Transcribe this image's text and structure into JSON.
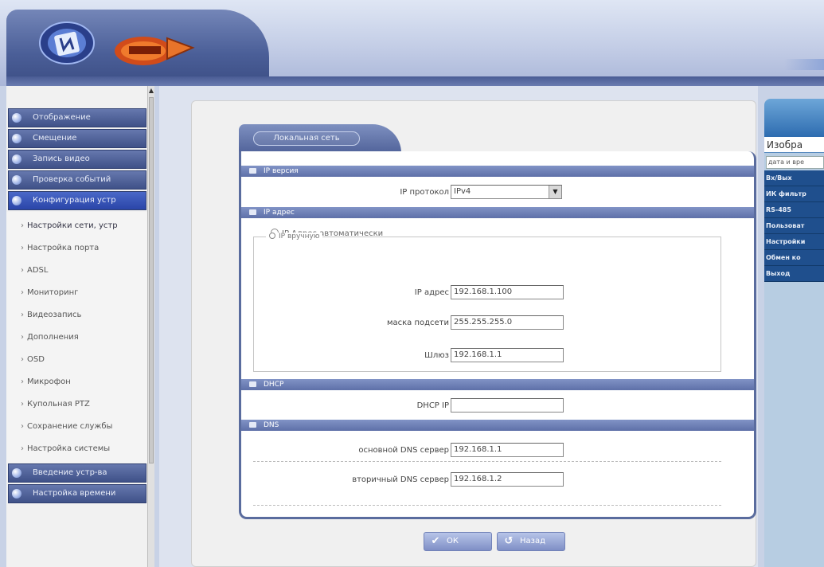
{
  "sidebar": {
    "main_items_top": [
      {
        "label": "Отображение"
      },
      {
        "label": "Смещение"
      },
      {
        "label": "Запись видео"
      },
      {
        "label": "Проверка событий"
      },
      {
        "label": "Конфигурация устр"
      }
    ],
    "sub_items": [
      {
        "label": "Настройки сети, устр"
      },
      {
        "label": "Настройка порта"
      },
      {
        "label": "ADSL"
      },
      {
        "label": "Мониторинг"
      },
      {
        "label": "Видеозапись"
      },
      {
        "label": "Дополнения"
      },
      {
        "label": "OSD"
      },
      {
        "label": "Микрофон"
      },
      {
        "label": "Купольная PTZ"
      },
      {
        "label": "Сохранение службы"
      },
      {
        "label": "Настройка системы"
      }
    ],
    "main_items_bottom": [
      {
        "label": "Введение устр-ва"
      },
      {
        "label": "Настройка времени"
      }
    ]
  },
  "form": {
    "tab_label": "Локальная сеть",
    "section_ip_version": "IP версия",
    "ip_protocol_label": "IP протокол",
    "ip_protocol_value": "IPv4",
    "section_ip_address": "IP адрес",
    "radio_auto_label": "IP Адрес автоматически",
    "fieldset_legend": "IP вручную",
    "ip_address_label": "IP адрес",
    "ip_address_value": "192.168.1.100",
    "subnet_label": "маска подсети",
    "subnet_value": "255.255.255.0",
    "gateway_label": "Шлюз",
    "gateway_value": "192.168.1.1",
    "section_dhcp": "DHCP",
    "dhcp_ip_label": "DHCP IP",
    "dhcp_ip_value": "",
    "section_dns": "DNS",
    "dns_primary_label": "основной DNS сервер",
    "dns_primary_value": "192.168.1.1",
    "dns_secondary_label": "вторичный DNS сервер",
    "dns_secondary_value": "192.168.1.2",
    "ok_label": "ОК",
    "refresh_label": "Назад"
  },
  "right_panel": {
    "title": "Изобра",
    "date_field": "дата и вре",
    "menu_items": [
      {
        "label": "Вх/Вых"
      },
      {
        "label": "ИК фильтр"
      },
      {
        "label": "RS-485"
      },
      {
        "label": "Пользоват"
      },
      {
        "label": "Настройки"
      },
      {
        "label": "Обмен ко"
      },
      {
        "label": "Выход"
      }
    ]
  },
  "colors": {
    "accent": "#5a6c9e",
    "sidebar_item": "#3f5188",
    "right_menu": "#1f4f8d"
  }
}
